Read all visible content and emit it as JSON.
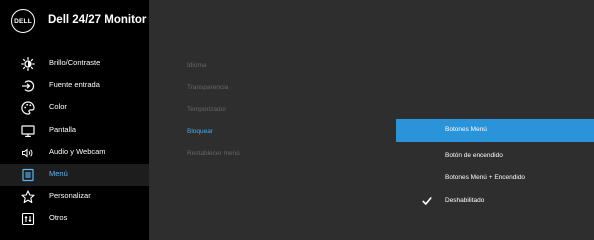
{
  "header": {
    "logo_text": "DELL",
    "title": "Dell 24/27 Monitor"
  },
  "sidebar": {
    "items": [
      {
        "label": "Brillo/Contraste",
        "icon": "brightness-icon"
      },
      {
        "label": "Fuente entrada",
        "icon": "input-source-icon"
      },
      {
        "label": "Color",
        "icon": "color-palette-icon"
      },
      {
        "label": "Pantalla",
        "icon": "display-icon"
      },
      {
        "label": "Audio y Webcam",
        "icon": "audio-icon"
      },
      {
        "label": "Menú",
        "icon": "menu-icon",
        "active": true
      },
      {
        "label": "Personalizar",
        "icon": "star-icon"
      },
      {
        "label": "Otros",
        "icon": "others-icon"
      }
    ]
  },
  "submenu": {
    "items": [
      {
        "label": "Idioma"
      },
      {
        "label": "Transparencia"
      },
      {
        "label": "Temporizador"
      },
      {
        "label": "Bloquear",
        "active": true
      },
      {
        "label": "Restablecer menú"
      }
    ]
  },
  "options": {
    "items": [
      {
        "label": "Botones Menú",
        "highlighted": true
      },
      {
        "label": "Botón de encendido"
      },
      {
        "label": "Botones Menú + Encendido"
      },
      {
        "label": "Deshabilitado",
        "checked": true
      }
    ]
  },
  "colors": {
    "panel_background": "#2e2e2e",
    "sidebar_background": "#000000",
    "accent": "#2a93d9",
    "active_text": "#5cb5f5",
    "disabled_text": "#666666"
  }
}
